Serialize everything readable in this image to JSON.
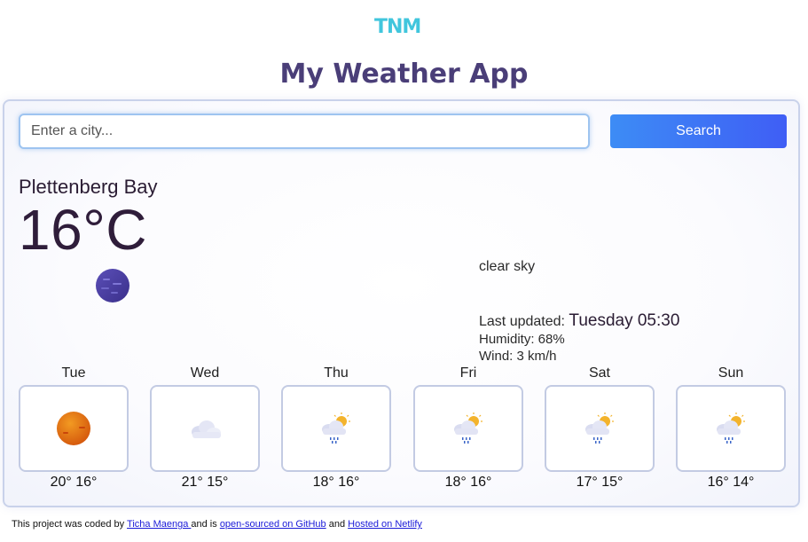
{
  "logo": {
    "text": "TNM"
  },
  "app": {
    "title": "My Weather App"
  },
  "search": {
    "placeholder": "Enter a city...",
    "value": "",
    "button_label": "Search"
  },
  "current": {
    "city": "Plettenberg Bay",
    "temperature": "16°C",
    "icon": "moon-night-icon",
    "description": "clear sky",
    "last_updated_label": "Last updated: ",
    "last_updated_value": "Tuesday 05:30",
    "humidity": "Humidity: 68%",
    "wind": "Wind: 3 km/h"
  },
  "forecast": [
    {
      "day": "Tue",
      "temps": "20° 16°",
      "icon": "sun-icon"
    },
    {
      "day": "Wed",
      "temps": "21° 15°",
      "icon": "cloud-icon"
    },
    {
      "day": "Thu",
      "temps": "18° 16°",
      "icon": "sun-rain-cloud-icon"
    },
    {
      "day": "Fri",
      "temps": "18° 16°",
      "icon": "sun-rain-cloud-icon"
    },
    {
      "day": "Sat",
      "temps": "17° 15°",
      "icon": "sun-rain-cloud-icon"
    },
    {
      "day": "Sun",
      "temps": "16° 14°",
      "icon": "sun-rain-cloud-icon"
    }
  ],
  "footer": {
    "text1": "This project was coded by ",
    "author_link": "Ticha Maenga ",
    "text2": "and is ",
    "github_link": "open-sourced on GitHub",
    "text3": " and ",
    "netlify_link": "Hosted on Netlify"
  },
  "colors": {
    "accent": "#3f5ef5",
    "title": "#4a3e78",
    "logo": "#41c6dd"
  }
}
